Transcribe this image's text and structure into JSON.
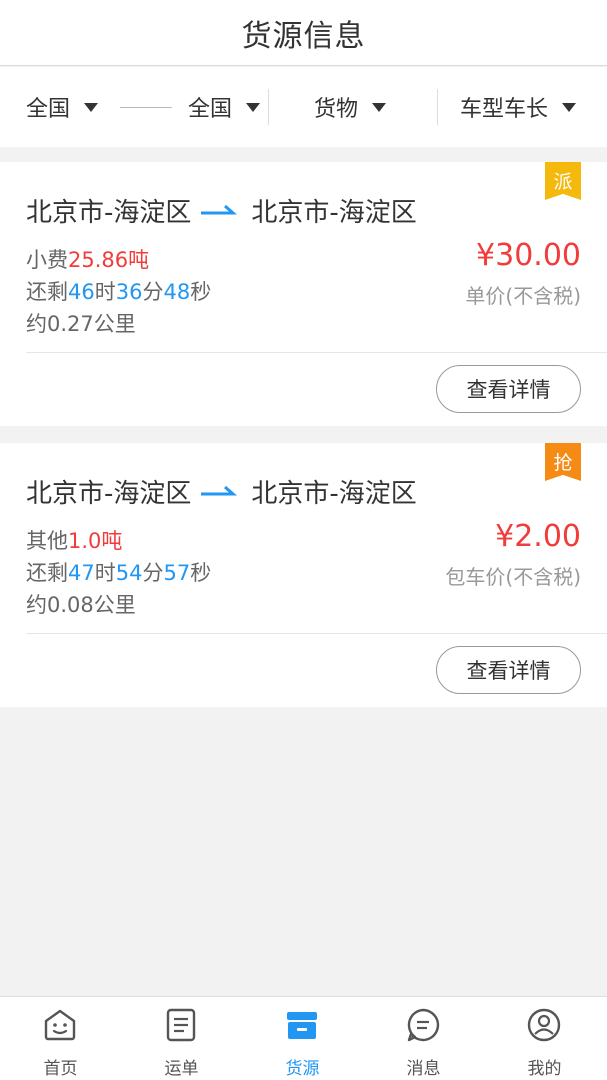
{
  "header": {
    "title": "货源信息"
  },
  "filters": {
    "origin": "全国",
    "destination": "全国",
    "goods": "货物",
    "truck": "车型车长"
  },
  "cards": [
    {
      "tag": "派",
      "tag_color": "#f5b90e",
      "from": "北京市-海淀区",
      "to": "北京市-海淀区",
      "goods_name": "小费",
      "weight": "25.86吨",
      "remain_prefix": "还剩",
      "hours": "46",
      "hours_unit": "时",
      "minutes": "36",
      "minutes_unit": "分",
      "seconds": "48",
      "seconds_unit": "秒",
      "distance": "约0.27公里",
      "price": "¥30.00",
      "price_note": "单价(不含税)",
      "button": "查看详情"
    },
    {
      "tag": "抢",
      "tag_color": "#f58a14",
      "from": "北京市-海淀区",
      "to": "北京市-海淀区",
      "goods_name": "其他",
      "weight": "1.0吨",
      "remain_prefix": "还剩",
      "hours": "47",
      "hours_unit": "时",
      "minutes": "54",
      "minutes_unit": "分",
      "seconds": "57",
      "seconds_unit": "秒",
      "distance": "约0.08公里",
      "price": "¥2.00",
      "price_note": "包车价(不含税)",
      "button": "查看详情"
    }
  ],
  "tabbar": [
    {
      "label": "首页",
      "icon": "home-face-icon",
      "active": false
    },
    {
      "label": "运单",
      "icon": "waybill-list-icon",
      "active": false
    },
    {
      "label": "货源",
      "icon": "cargo-box-icon",
      "active": true
    },
    {
      "label": "消息",
      "icon": "message-bubble-icon",
      "active": false
    },
    {
      "label": "我的",
      "icon": "user-profile-icon",
      "active": false
    }
  ],
  "colors": {
    "accent": "#2196f3",
    "price_red": "#f23b3b",
    "tag_yellow": "#f5b90e",
    "tag_orange": "#f58a14"
  }
}
